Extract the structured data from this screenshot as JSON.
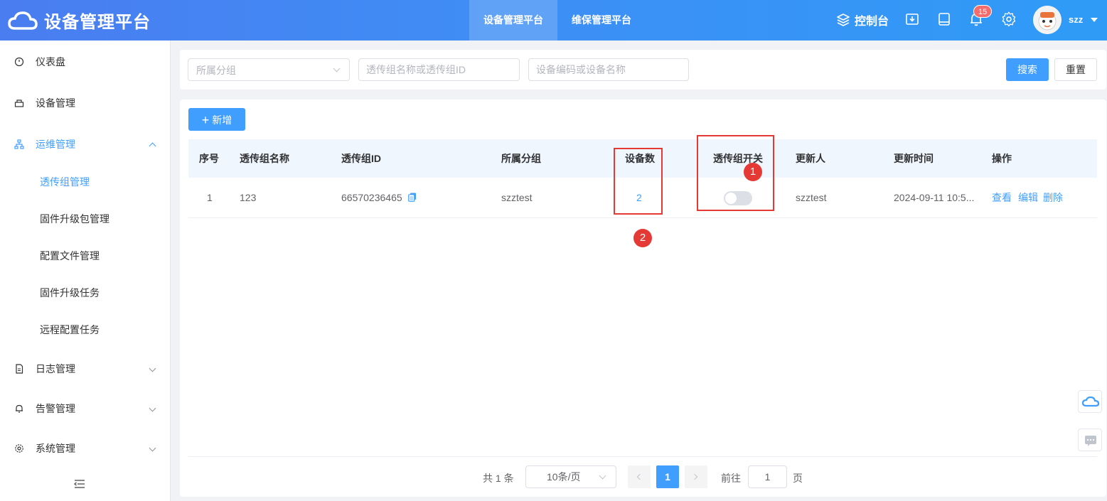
{
  "header": {
    "title": "设备管理平台",
    "nav": [
      {
        "label": "设备管理平台",
        "active": true
      },
      {
        "label": "维保管理平台",
        "active": false
      }
    ],
    "console_label": "控制台",
    "notification_count": "15",
    "username": "szz"
  },
  "sidebar": {
    "items": [
      {
        "label": "仪表盘",
        "icon": "dashboard-icon"
      },
      {
        "label": "设备管理",
        "icon": "device-icon"
      },
      {
        "label": "运维管理",
        "icon": "network-icon",
        "expanded": true
      },
      {
        "label": "日志管理",
        "icon": "document-icon"
      },
      {
        "label": "告警管理",
        "icon": "bell-icon"
      },
      {
        "label": "系统管理",
        "icon": "gear-icon"
      }
    ],
    "subitems": [
      {
        "label": "透传组管理",
        "active": true
      },
      {
        "label": "固件升级包管理"
      },
      {
        "label": "配置文件管理"
      },
      {
        "label": "固件升级任务"
      },
      {
        "label": "远程配置任务"
      }
    ]
  },
  "search": {
    "group_placeholder": "所属分组",
    "name_placeholder": "透传组名称或透传组ID",
    "device_placeholder": "设备编码或设备名称",
    "search_label": "搜索",
    "reset_label": "重置"
  },
  "toolbar": {
    "add_label": "新增"
  },
  "table": {
    "columns": [
      "序号",
      "透传组名称",
      "透传组ID",
      "所属分组",
      "设备数",
      "透传组开关",
      "更新人",
      "更新时间",
      "操作"
    ],
    "rows": [
      {
        "index": "1",
        "name": "123",
        "id": "66570236465",
        "group": "szztest",
        "device_count": "2",
        "switch_on": false,
        "updater": "szztest",
        "update_time": "2024-09-11 10:5...",
        "actions": [
          "查看",
          "编辑",
          "删除"
        ]
      }
    ]
  },
  "annotations": [
    "1",
    "2"
  ],
  "pagination": {
    "total": "共 1 条",
    "page_size": "10条/页",
    "current_page": "1",
    "goto_label": "前往",
    "goto_value": "1",
    "page_unit": "页"
  },
  "colors": {
    "primary": "#409eff",
    "header_gradient_start": "#4a7df0",
    "header_gradient_end": "#2f9bf7",
    "annotation_red": "#e53935",
    "badge_red": "#f56c6c"
  }
}
